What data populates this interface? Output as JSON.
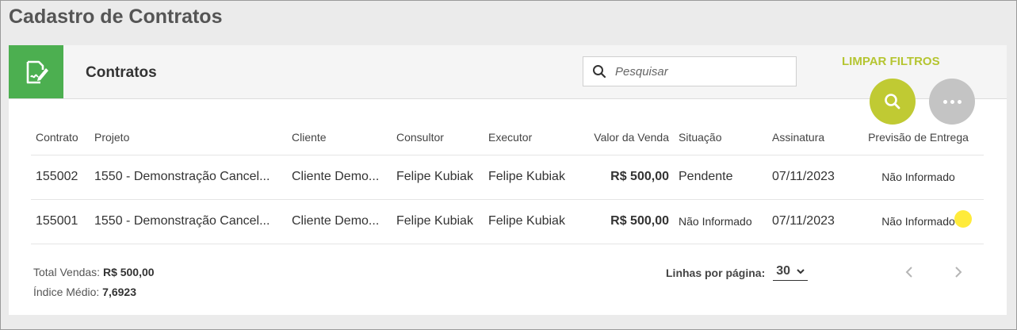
{
  "page": {
    "title": "Cadastro de Contratos"
  },
  "card": {
    "title": "Contratos",
    "search": {
      "placeholder": "Pesquisar",
      "value": ""
    },
    "clear_filters_label": "LIMPAR FILTROS"
  },
  "table": {
    "headers": {
      "contrato": "Contrato",
      "projeto": "Projeto",
      "cliente": "Cliente",
      "consultor": "Consultor",
      "executor": "Executor",
      "valor": "Valor da Venda",
      "situacao": "Situação",
      "assinatura": "Assinatura",
      "previsao": "Previsão de Entrega"
    },
    "rows": [
      {
        "contrato": "155002",
        "projeto": "1550 - Demonstração Cancel...",
        "cliente": "Cliente Demo...",
        "consultor": "Felipe Kubiak",
        "executor": "Felipe Kubiak",
        "valor": "R$ 500,00",
        "situacao": "Pendente",
        "assinatura": "07/11/2023",
        "previsao": "Não Informado"
      },
      {
        "contrato": "155001",
        "projeto": "1550 - Demonstração Cancel...",
        "cliente": "Cliente Demo...",
        "consultor": "Felipe Kubiak",
        "executor": "Felipe Kubiak",
        "valor": "R$ 500,00",
        "situacao": "Não Informado",
        "assinatura": "07/11/2023",
        "previsao": "Não Informado"
      }
    ]
  },
  "footer": {
    "total_label": "Total Vendas:",
    "total_value": "R$ 500,00",
    "index_label": "Índice Médio:",
    "index_value": "7,6923",
    "rows_per_page_label": "Linhas por página:",
    "rows_per_page_value": "30"
  },
  "colors": {
    "accent_green": "#4caf50",
    "lime": "#c0ca33",
    "link_blue": "#2979c1",
    "status_yellow": "#ffeb3b"
  }
}
